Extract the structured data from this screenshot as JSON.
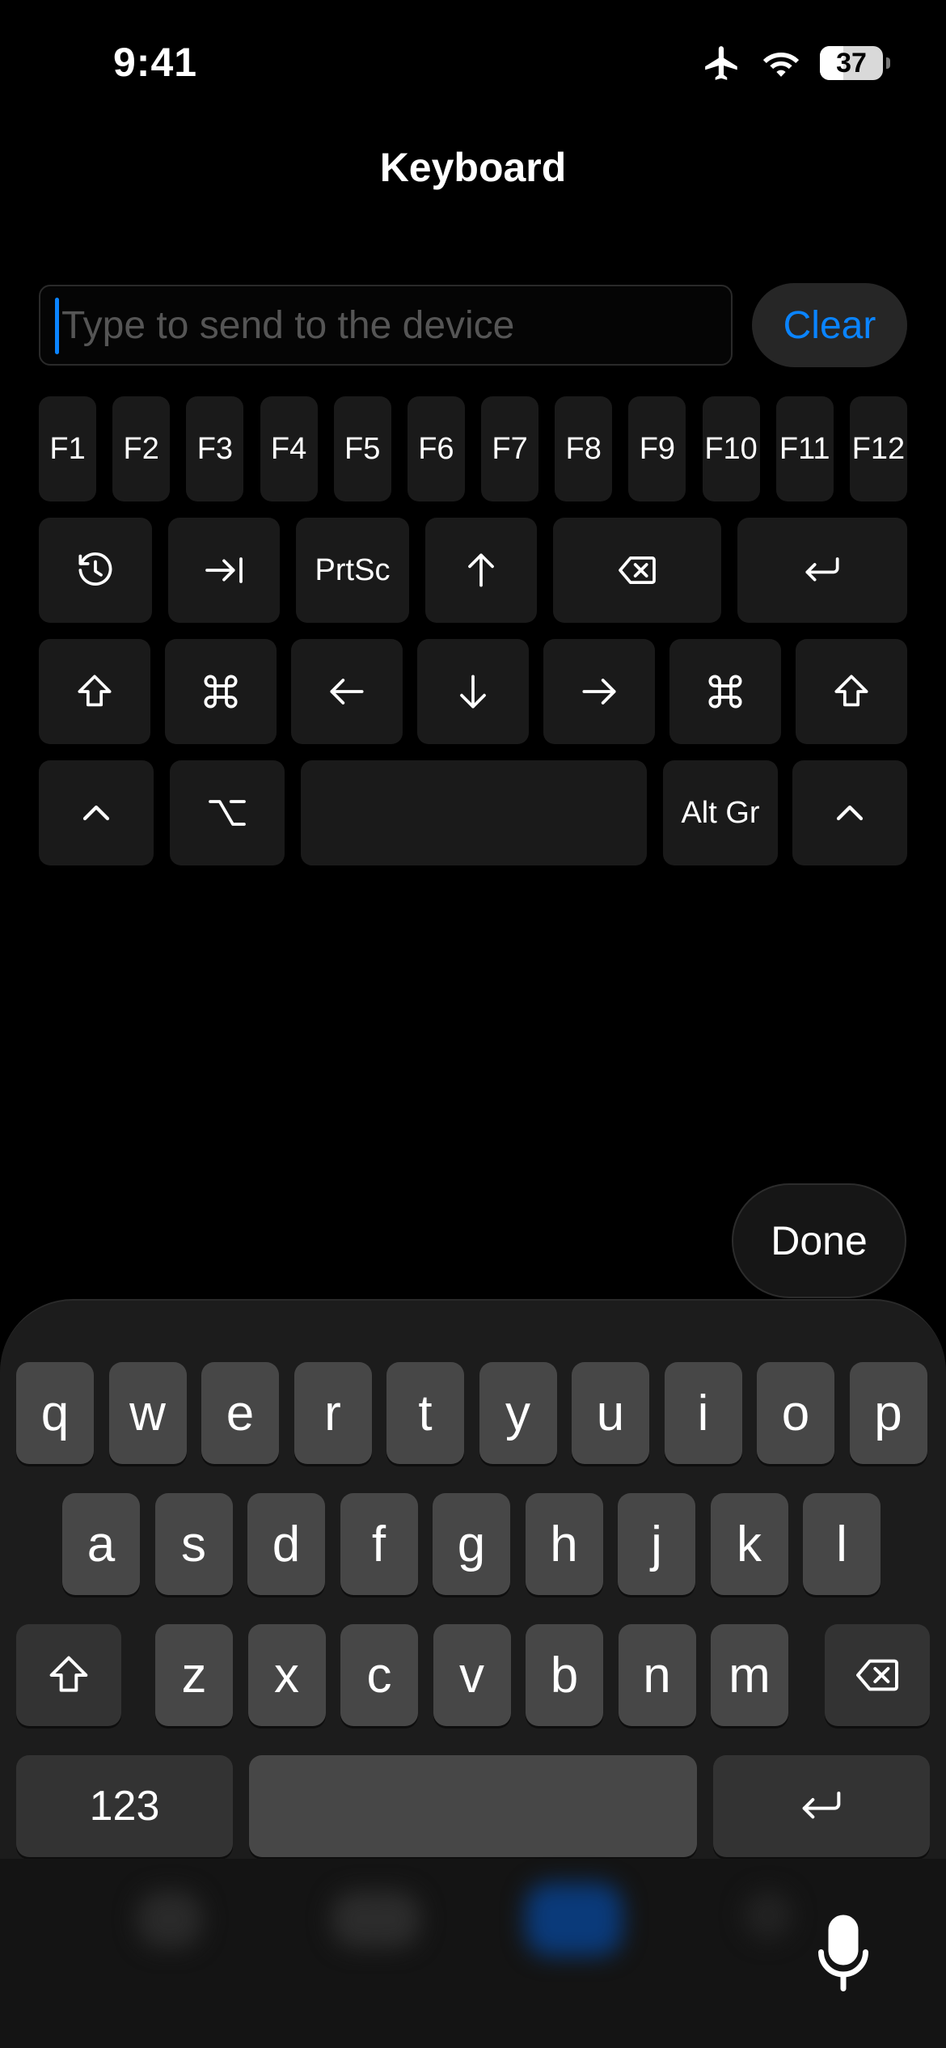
{
  "status_bar": {
    "time": "9:41",
    "battery": "37",
    "battery_level": 0.37
  },
  "title": "Keyboard",
  "input": {
    "placeholder": "Type to send to the device",
    "value": ""
  },
  "clear_label": "Clear",
  "function_keys": [
    "F1",
    "F2",
    "F3",
    "F4",
    "F5",
    "F6",
    "F7",
    "F8",
    "F9",
    "F10",
    "F11",
    "F12"
  ],
  "row2": {
    "history_icon": "history-icon",
    "tab_icon": "tab-icon",
    "prtsc": "PrtSc",
    "up_icon": "arrow-up-icon",
    "delete_icon": "delete-icon",
    "enter_icon": "return-icon"
  },
  "row3": [
    "shift-icon",
    "command-icon",
    "arrow-left-icon",
    "arrow-down-icon",
    "arrow-right-icon",
    "command-icon",
    "shift-icon"
  ],
  "row4": {
    "ctrl_icon": "control-icon",
    "option_icon": "option-icon",
    "altgr": "Alt Gr"
  },
  "done_label": "Done",
  "system_keyboard": {
    "row1": [
      "q",
      "w",
      "e",
      "r",
      "t",
      "y",
      "u",
      "i",
      "o",
      "p"
    ],
    "row2": [
      "a",
      "s",
      "d",
      "f",
      "g",
      "h",
      "j",
      "k",
      "l"
    ],
    "row3": [
      "z",
      "x",
      "c",
      "v",
      "b",
      "n",
      "m"
    ],
    "numbers_label": "123"
  }
}
